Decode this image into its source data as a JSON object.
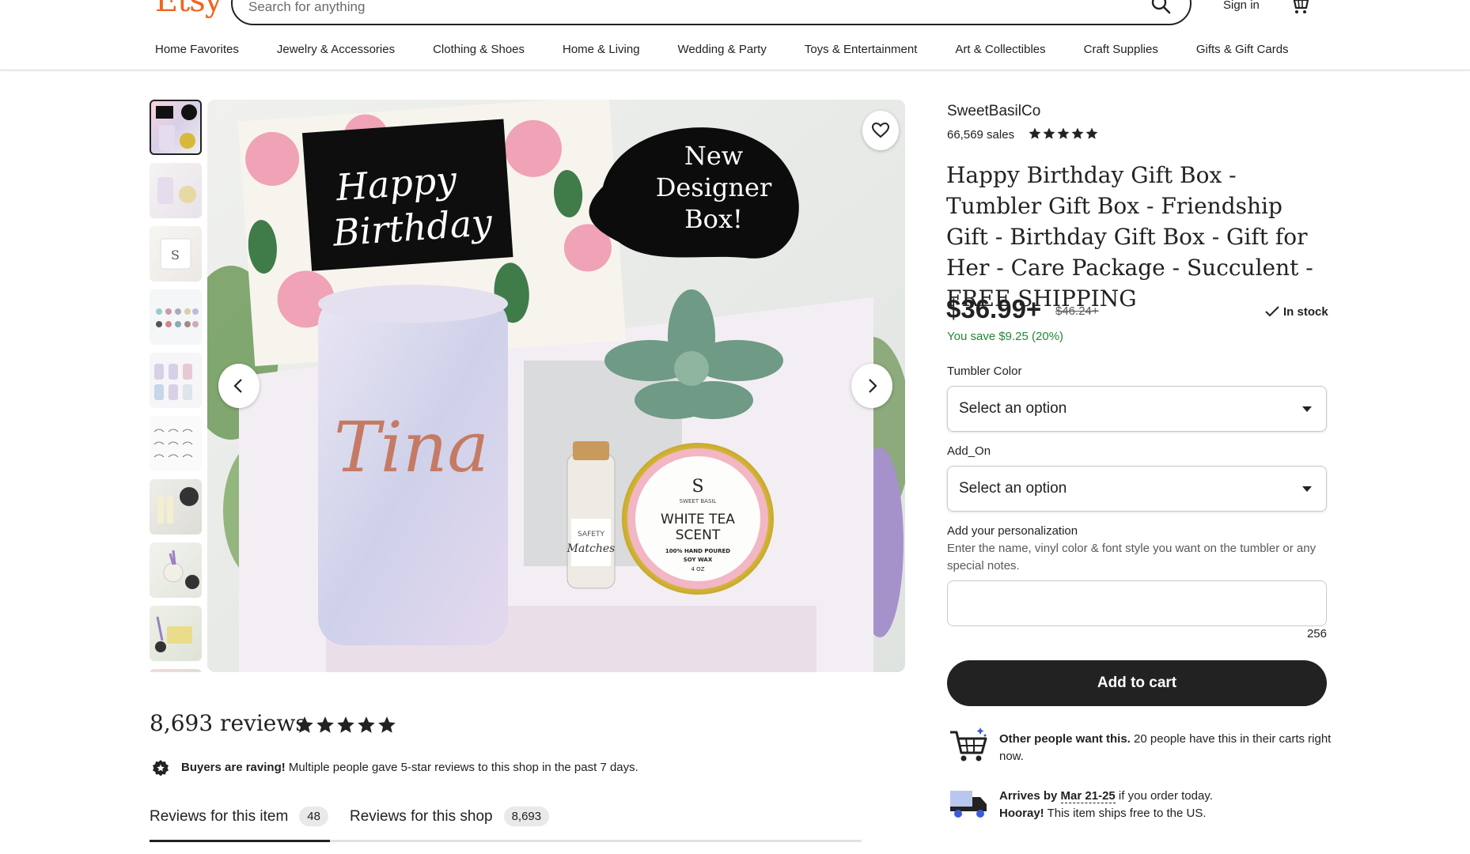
{
  "header": {
    "logo": "Etsy",
    "search_placeholder": "Search for anything",
    "signin": "Sign in"
  },
  "nav": [
    "Home Favorites",
    "Jewelry & Accessories",
    "Clothing & Shoes",
    "Home & Living",
    "Wedding & Party",
    "Toys & Entertainment",
    "Art & Collectibles",
    "Craft Supplies",
    "Gifts & Gift Cards"
  ],
  "gallery": {
    "image_text": {
      "card": "Happy Birthday",
      "badge": "New Designer Box!",
      "tumbler_name": "Tina",
      "matches_label": "SAFETY Matches",
      "candle_brand": "SWEET BASIL",
      "candle_scent": "WHITE TEA SCENT",
      "candle_desc": "100% HAND POURED SOY WAX",
      "candle_size": "4 OZ"
    }
  },
  "listing": {
    "shop_name": "SweetBasilCo",
    "sales": "66,569 sales",
    "rating": 5,
    "title": "Happy Birthday Gift Box - Tumbler Gift Box - Friendship Gift - Birthday Gift Box - Gift for Her - Care Package - Succulent - FREE SHIPPING",
    "price": "$36.99+",
    "original_price": "$46.24+",
    "stock": "In stock",
    "savings": "You save $9.25 (20%)"
  },
  "options": {
    "tumbler_color_label": "Tumbler Color",
    "tumbler_color_value": "Select an option",
    "addon_label": "Add_On",
    "addon_value": "Select an option"
  },
  "personalization": {
    "label": "Add your personalization",
    "help": "Enter the name, vinyl color & font style you want on the tumbler or any special notes.",
    "chars_left": "256"
  },
  "cta": {
    "add_to_cart": "Add to cart"
  },
  "info": {
    "demand_bold": "Other people want this.",
    "demand_text": " 20 people have this in their carts right now.",
    "arrives_bold_prefix": "Arrives by ",
    "arrives_date": "Mar 21-25",
    "arrives_suffix": " if you order today.",
    "hooray_bold": "Hooray!",
    "hooray_text": " This item ships free to the US."
  },
  "reviews": {
    "title": "8,693 reviews",
    "rating": 5,
    "raving_bold": "Buyers are raving!",
    "raving_text": " Multiple people gave 5-star reviews to this shop in the past 7 days.",
    "tab_item_label": "Reviews for this item",
    "tab_item_count": "48",
    "tab_shop_label": "Reviews for this shop",
    "tab_shop_count": "8,693"
  },
  "colors": {
    "brand": "#f1641e",
    "text": "#222222",
    "savings": "#258635",
    "button": "#222222"
  }
}
